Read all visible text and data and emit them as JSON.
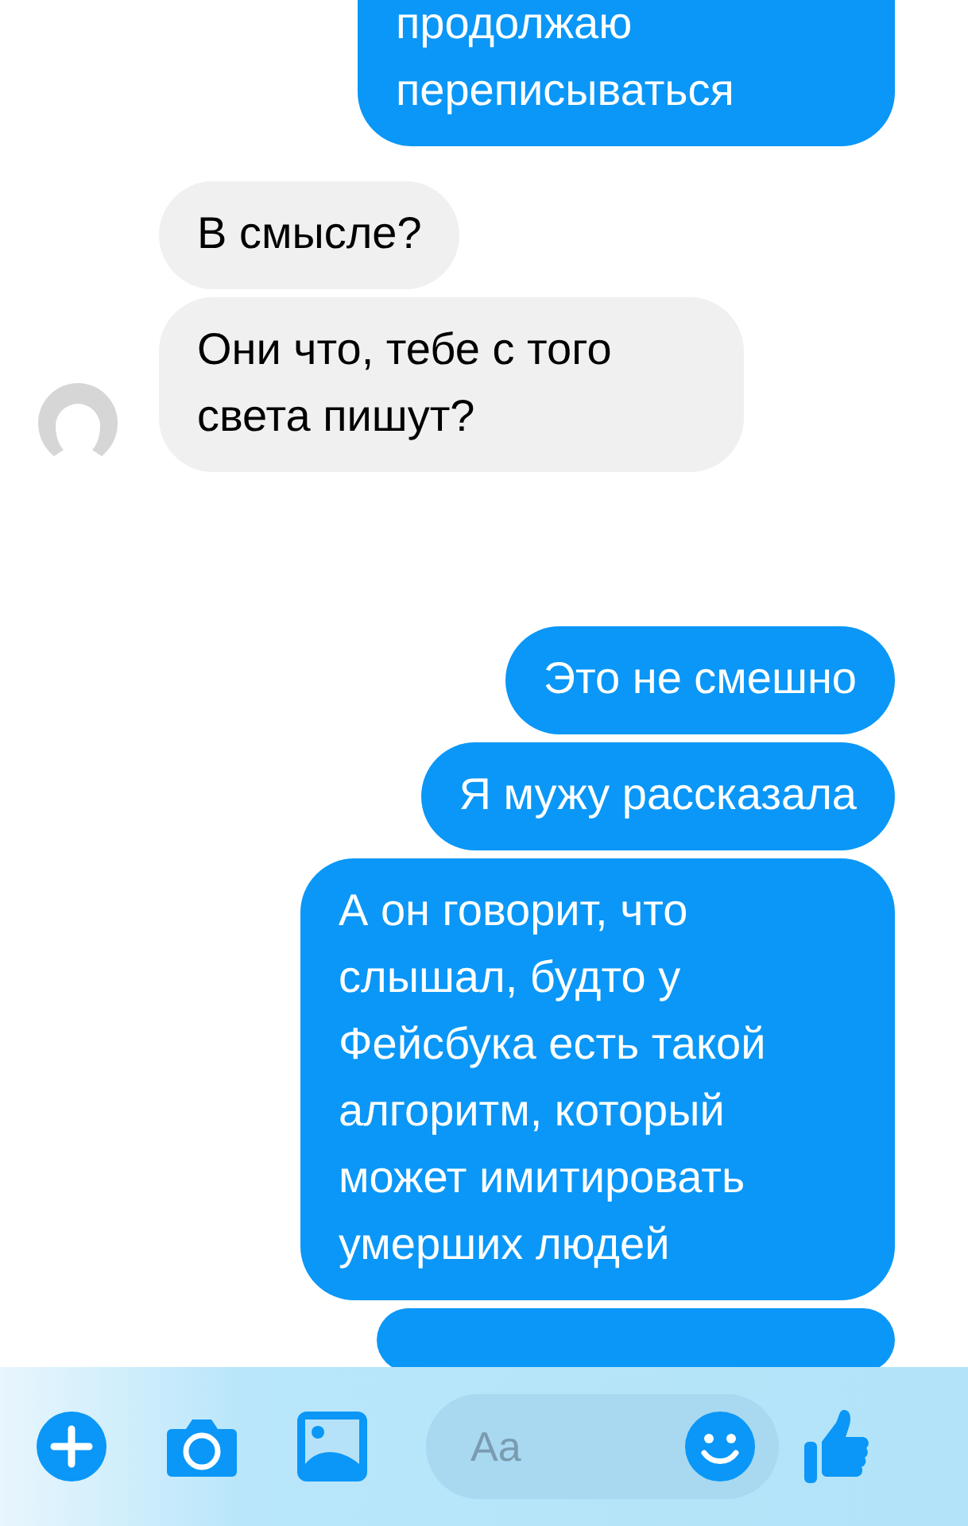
{
  "messages": [
    {
      "kind": "outgoing",
      "text": "продолжаю переписываться",
      "cut_top": true
    },
    {
      "kind": "incoming",
      "text": "В смысле?",
      "cut_top": false
    },
    {
      "kind": "incoming",
      "text": "Они что, тебе с того света пишут?",
      "cut_top": false
    },
    {
      "kind": "outgoing",
      "text": "Это не смешно",
      "cut_top": false
    },
    {
      "kind": "outgoing",
      "text": "Я мужу рассказала",
      "cut_top": false
    },
    {
      "kind": "outgoing",
      "text": "А он говорит, что слышал, будто у Фейсбука есть такой алгоритм, который может имитировать умерших людей",
      "cut_top": false
    },
    {
      "kind": "outgoing",
      "cut_top": false
    }
  ],
  "composer": {
    "placeholder": "Aa"
  }
}
